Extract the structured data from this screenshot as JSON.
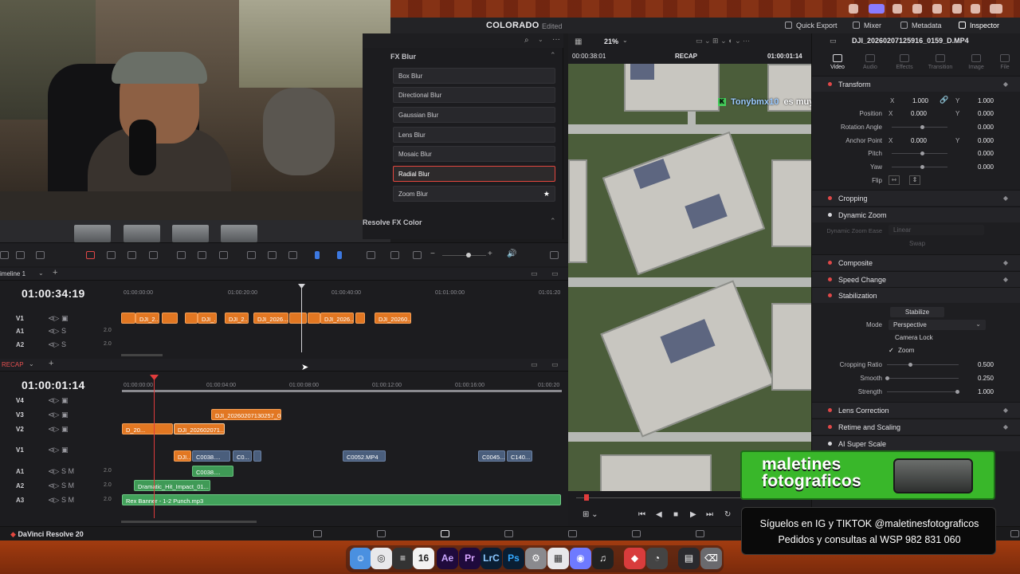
{
  "app": {
    "name": "DaVinci Resolve 20",
    "project_title": "COLORADO",
    "project_status": "Edited"
  },
  "topbar": {
    "quick_export": "Quick Export",
    "mixer": "Mixer",
    "metadata": "Metadata",
    "inspector": "Inspector"
  },
  "viewer": {
    "zoom": "21%",
    "source_tc": "00:00:38:01",
    "timeline_name": "RECAP",
    "record_tc": "01:00:01:14",
    "chat_user": "Tonybmx10",
    "chat_msg": "es muy buena una A7III"
  },
  "effects": {
    "section_blur": "FX Blur",
    "items": [
      "Box Blur",
      "Directional Blur",
      "Gaussian Blur",
      "Lens Blur",
      "Mosaic Blur",
      "Radial Blur",
      "Zoom Blur"
    ],
    "selected": "Radial Blur",
    "section_color": "Resolve FX Color"
  },
  "inspector": {
    "clip_name": "DJI_20260207125916_0159_D.MP4",
    "tabs": [
      "Video",
      "Audio",
      "Effects",
      "Transition",
      "Image",
      "File"
    ],
    "sections": {
      "transform": "Transform",
      "cropping": "Cropping",
      "dynamic_zoom": "Dynamic Zoom",
      "composite": "Composite",
      "speed_change": "Speed Change",
      "stabilization": "Stabilization",
      "lens_correction": "Lens Correction",
      "retime_scaling": "Retime and Scaling",
      "ai_super_scale": "AI Super Scale"
    },
    "transform": {
      "zoom_x": "1.000",
      "zoom_y": "1.000",
      "position_label": "Position",
      "position_x": "0.000",
      "position_y": "0.000",
      "rotation_label": "Rotation Angle",
      "rotation": "0.000",
      "anchor_label": "Anchor Point",
      "anchor_x": "0.000",
      "anchor_y": "0.000",
      "pitch_label": "Pitch",
      "pitch": "0.000",
      "yaw_label": "Yaw",
      "yaw": "0.000",
      "flip_label": "Flip"
    },
    "dynamic_zoom_ease_label": "Dynamic Zoom Ease",
    "dynamic_zoom_ease": "Linear",
    "swap": "Swap",
    "stabilize_button": "Stabilize",
    "mode_label": "Mode",
    "mode_value": "Perspective",
    "camera_lock": "Camera Lock",
    "zoom_check": "Zoom",
    "cropping_ratio_label": "Cropping Ratio",
    "cropping_ratio": "0.500",
    "smooth_label": "Smooth",
    "smooth": "0.250",
    "strength_label": "Strength",
    "strength": "1.000"
  },
  "timeline1": {
    "name": "imeline 1",
    "timecode": "01:00:34:19",
    "ruler": [
      "01:00:00:00",
      "01:00:20:00",
      "01:00:40:00",
      "01:01:00:00",
      "01:01:20"
    ],
    "tracks": [
      "V1",
      "A1",
      "A2"
    ],
    "audio_level": "2.0",
    "clips": [
      "DJI_2...",
      "DJI_...",
      "DJI_2...",
      "DJI_2026...",
      "DJI_2026...",
      "DJI_20260..."
    ]
  },
  "timeline2": {
    "name": "RECAP",
    "timecode": "01:00:01:14",
    "ruler": [
      "01:00:00:00",
      "01:00:04:00",
      "01:00:08:00",
      "01:00:12:00",
      "01:00:16:00",
      "01:00:20"
    ],
    "tracks": [
      "V4",
      "V3",
      "V2",
      "V1",
      "A1",
      "A2",
      "A3"
    ],
    "audio_level": "2.0",
    "clips": {
      "v3": "DJI_20260207130257_0...",
      "v2a": "D_20...",
      "v2b": "DJI_202602071...",
      "v1a": "DJI...",
      "v1b": "C0038....",
      "v1c": "C0...",
      "v1d": "C0052.MP4",
      "v1e": "C0045....",
      "v1f": "C140...",
      "a1": "C0038....",
      "a2": "Dramatic_Hit_Impact_01...",
      "a3": "Rex Banner - 1-2 Punch.mp3"
    }
  },
  "dock": {
    "calendar_day": "16",
    "apps": [
      "Ae",
      "Pr",
      "LrC",
      "Ps"
    ]
  },
  "overlay": {
    "promo_line1": "maletines",
    "promo_line2": "fotograficos",
    "social_line1": "Síguelos en IG y TIKTOK @maletinesfotograficos",
    "social_line2": "Pedidos y consultas al WSP 982 831 060"
  },
  "colors": {
    "accent_red": "#e3473f",
    "clip_orange": "#e27722",
    "clip_blue": "#4a5e7c",
    "clip_green": "#3f9a56",
    "promo_green": "#39b72a"
  }
}
